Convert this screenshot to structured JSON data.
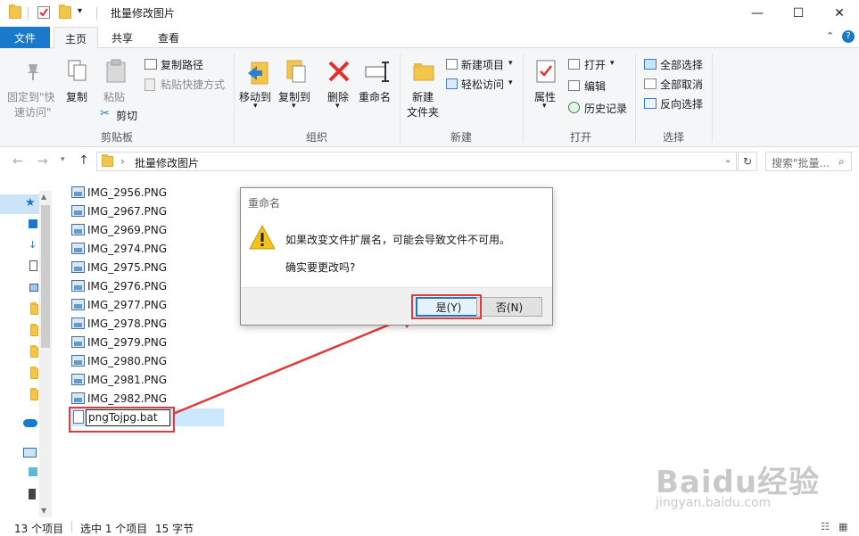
{
  "window": {
    "title": "批量修改图片"
  },
  "ribbon_tabs": [
    "文件",
    "主页",
    "共享",
    "查看"
  ],
  "clipboard": {
    "pin_line1": "固定到\"快",
    "pin_line2": "速访问\"",
    "copy": "复制",
    "paste": "粘贴",
    "copy_path": "复制路径",
    "paste_shortcut": "粘贴快捷方式",
    "cut": "剪切",
    "label": "剪贴板"
  },
  "organize": {
    "move_to": "移动到",
    "copy_to": "复制到",
    "delete": "删除",
    "rename": "重命名",
    "label": "组织"
  },
  "new_group": {
    "new_folder_line1": "新建",
    "new_folder_line2": "文件夹",
    "new_item": "新建项目",
    "easy_access": "轻松访问",
    "label": "新建"
  },
  "open_group": {
    "properties": "属性",
    "open": "打开",
    "edit": "编辑",
    "history": "历史记录",
    "label": "打开"
  },
  "select_group": {
    "select_all": "全部选择",
    "select_none": "全部取消",
    "invert": "反向选择",
    "label": "选择"
  },
  "address": {
    "path": "批量修改图片",
    "search_placeholder": "搜索\"批量..."
  },
  "files": [
    "IMG_2956.PNG",
    "IMG_2967.PNG",
    "IMG_2969.PNG",
    "IMG_2974.PNG",
    "IMG_2975.PNG",
    "IMG_2976.PNG",
    "IMG_2977.PNG",
    "IMG_2978.PNG",
    "IMG_2979.PNG",
    "IMG_2980.PNG",
    "IMG_2981.PNG",
    "IMG_2982.PNG"
  ],
  "rename_field": {
    "value": "pngTojpg.bat"
  },
  "dialog": {
    "title": "重命名",
    "message1": "如果改变文件扩展名，可能会导致文件不可用。",
    "message2": "确实要更改吗?",
    "yes": "是(Y)",
    "no": "否(N)"
  },
  "status": {
    "count": "13 个项目",
    "selected": "选中 1 个项目",
    "size": "15 字节"
  },
  "watermark": {
    "text": "Baidu经验",
    "url": "jingyan.baidu.com"
  },
  "colors": {
    "accent": "#1979ca",
    "annotation": "#e03a3a",
    "warning": "#f2c21b"
  }
}
